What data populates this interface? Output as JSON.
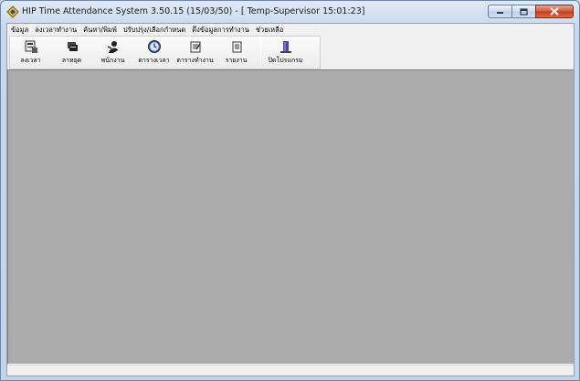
{
  "window": {
    "title": "HIP Time Attendance System 3.50.15 (15/03/50) - [ Temp-Supervisor 15:01:23]"
  },
  "menu": [
    {
      "label": "ข้อมูล"
    },
    {
      "label": "ลงเวลาทำงาน"
    },
    {
      "label": "ค้นหา/พิมพ์"
    },
    {
      "label": "ปรับปรุง/เลือกกำหนด"
    },
    {
      "label": "ดึงข้อมูลการทำงาน"
    },
    {
      "label": "ช่วยเหลือ"
    }
  ],
  "toolbar": {
    "buttons": [
      {
        "label": "ลงเวลา",
        "icon": "time-clock-icon"
      },
      {
        "label": "ลาหยุด",
        "icon": "leave-icon"
      },
      {
        "label": "พนักงาน",
        "icon": "employee-icon"
      },
      {
        "label": "ตารางเวลา",
        "icon": "clock-icon"
      },
      {
        "label": "ตารางทำงาน",
        "icon": "schedule-icon"
      },
      {
        "label": "รายงาน",
        "icon": "report-icon"
      }
    ],
    "exit": {
      "label": "ปิดโปรแกรม",
      "icon": "exit-door-icon"
    }
  },
  "colors": {
    "mdi_background": "#ababab",
    "chrome": "#f0f0f0",
    "close_button": "#c7391c"
  }
}
